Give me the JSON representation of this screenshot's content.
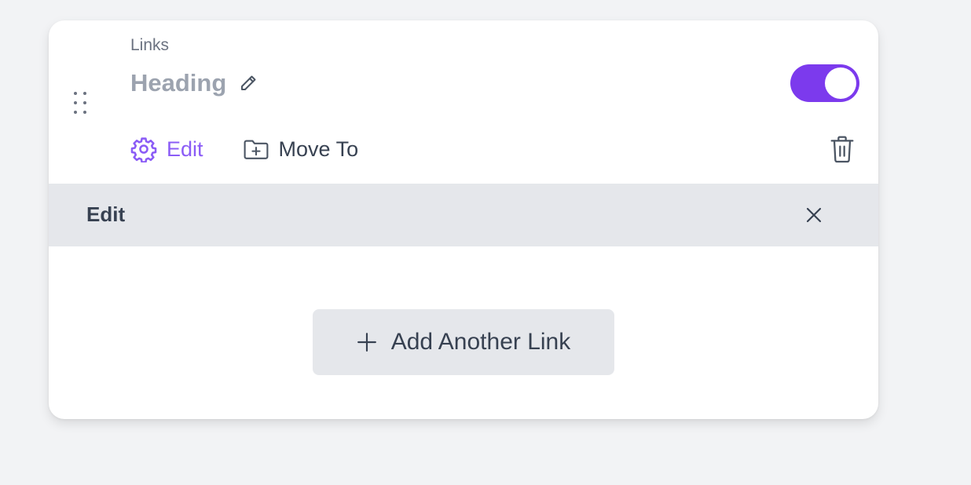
{
  "block": {
    "section_label": "Links",
    "heading": "Heading",
    "enabled": true
  },
  "actions": {
    "edit_label": "Edit",
    "move_label": "Move To"
  },
  "panel": {
    "title": "Edit",
    "add_button_label": "Add Another Link"
  },
  "icons": {
    "drag": "drag-handle-icon",
    "pencil": "pencil-icon",
    "gear": "gear-icon",
    "folder_plus": "folder-plus-icon",
    "trash": "trash-icon",
    "close": "close-icon",
    "plus": "plus-icon"
  },
  "colors": {
    "accent": "#7c3aed",
    "accent_text": "#8b5cf6",
    "panel_bg": "#e5e7eb",
    "page_bg": "#f2f3f5"
  }
}
